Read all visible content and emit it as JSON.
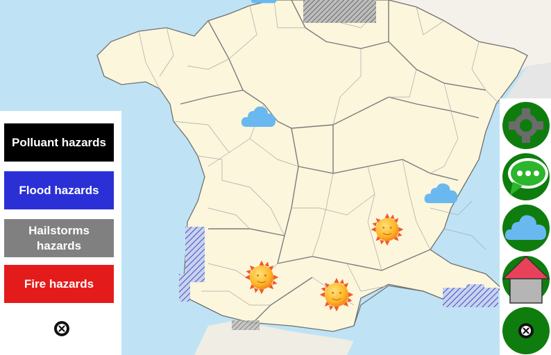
{
  "map": {
    "land_color": "#fbf6dc",
    "sea_color": "#bfe3f5",
    "neighbor_color": "#f4f1ea",
    "border_color": "#6f6f6f",
    "weather_icons": [
      "cloud-icon",
      "cloud-icon",
      "sun-icon",
      "sun-icon",
      "sun-icon"
    ]
  },
  "left_panel": {
    "buttons": [
      {
        "label": "Polluant hazards",
        "color": "#000000"
      },
      {
        "label": "Flood hazards",
        "color": "#2b30d6"
      },
      {
        "label": "Hailstorms hazards",
        "color": "#808080"
      },
      {
        "label": "Fire hazards",
        "color": "#e41b1b"
      }
    ],
    "close_icon": "close-icon"
  },
  "right_toolbar": {
    "accent_color": "#0e7d0e",
    "icons": [
      "gear-icon",
      "chat-bubble-icon",
      "cloud-icon",
      "house-icon",
      "close-icon"
    ]
  }
}
